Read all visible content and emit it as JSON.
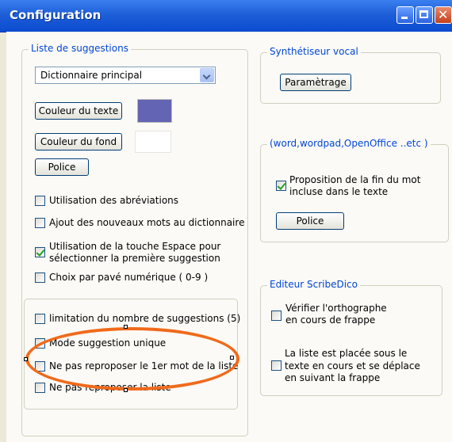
{
  "window": {
    "title": "Configuration"
  },
  "suggestions": {
    "legend": "Liste de suggestions",
    "dictionary_value": "Dictionnaire principal",
    "text_color_label": "Couleur du texte",
    "text_color": "#6464b4",
    "bg_color_label": "Couleur du fond",
    "bg_color": "#ffffff",
    "font_label": "Police",
    "options": [
      {
        "label": "Utilisation des abréviations",
        "checked": false
      },
      {
        "label": "Ajout des nouveaux mots au dictionnaire",
        "checked": false
      },
      {
        "label": "Utilisation de  la  touche Espace pour",
        "label2": "sélectionner la première suggestion",
        "checked": true
      },
      {
        "label": "Choix par pavé numérique ( 0-9 )",
        "checked": false
      }
    ],
    "limits": [
      {
        "label": "limitation du  nombre de suggestions (5)",
        "checked": false
      },
      {
        "label": "Mode suggestion unique",
        "checked": false
      },
      {
        "label": "Ne pas reproposer le 1er mot de la liste",
        "checked": false
      },
      {
        "label": "Ne pas reproposer la liste",
        "checked": false
      }
    ]
  },
  "synth": {
    "legend": "Synthétiseur vocal",
    "settings_label": "Paramètrage"
  },
  "apps": {
    "legend": "(word,wordpad,OpenOffice ..etc )",
    "proposition_line1": "Proposition de la fin  du mot",
    "proposition_line2": "incluse dans le texte",
    "proposition_checked": true,
    "font_label": "Police"
  },
  "editor": {
    "legend": "Editeur ScribeDico",
    "spell_line1": "Vérifier l'orthographe",
    "spell_line2": "en cours de frappe",
    "list_line1": "La liste est placée sous le",
    "list_line2": "texte en cours et se déplace",
    "list_line3": "en suivant la frappe"
  },
  "colors": {
    "annotation": "#f06a1a",
    "legend": "#0046d5"
  }
}
